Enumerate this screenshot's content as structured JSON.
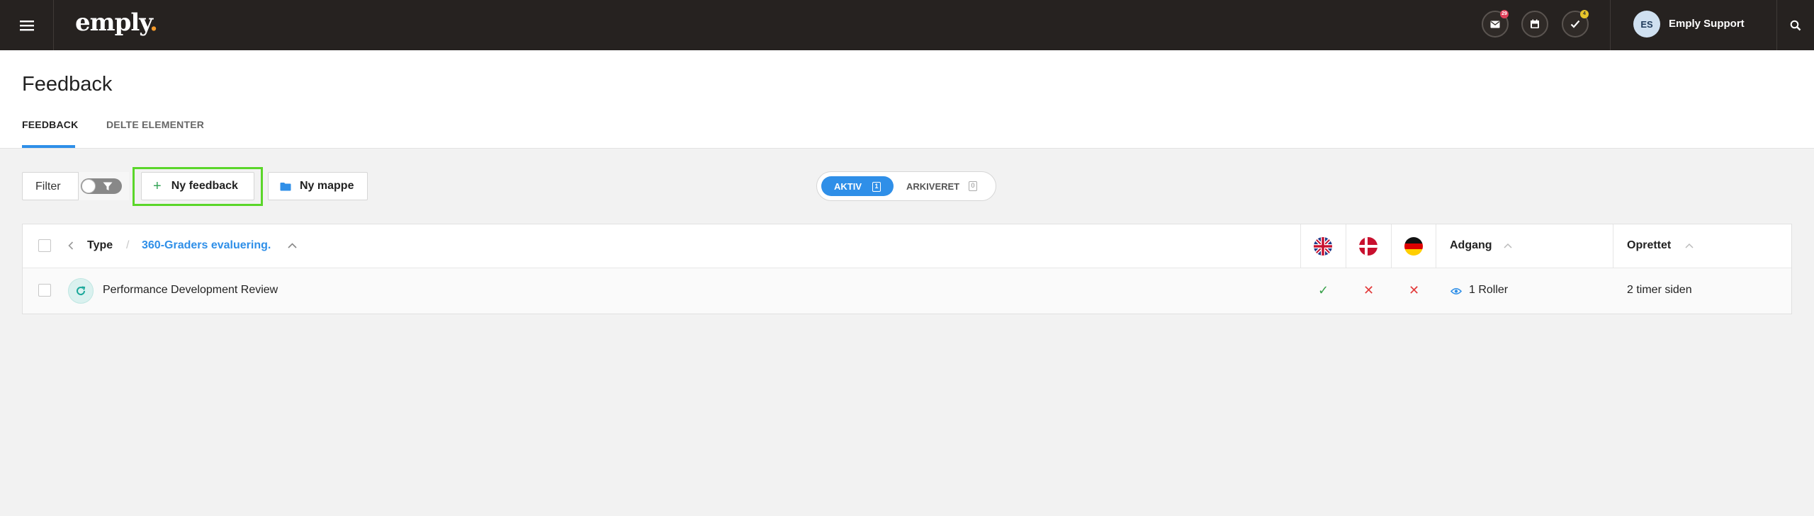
{
  "app": {
    "logo_text": "emply",
    "logo_dot": ".",
    "notifications": {
      "mail_badge": "29",
      "tasks_badge": "4"
    },
    "user": {
      "initials": "ES",
      "name": "Emply Support"
    }
  },
  "page": {
    "title": "Feedback",
    "tabs": [
      {
        "label": "FEEDBACK",
        "active": true
      },
      {
        "label": "DELTE ELEMENTER",
        "active": false
      }
    ]
  },
  "toolbar": {
    "filter_label": "Filter",
    "new_feedback_label": "Ny feedback",
    "new_folder_label": "Ny mappe",
    "status": {
      "active_label": "AKTIV",
      "active_count": "1",
      "archived_label": "ARKIVERET",
      "archived_count": "0"
    }
  },
  "table": {
    "breadcrumb": {
      "root": "Type",
      "separator": "/",
      "current": "360-Graders evaluering."
    },
    "columns": {
      "access": "Adgang",
      "created": "Oprettet"
    },
    "languages": [
      "english-flag-icon",
      "danish-flag-icon",
      "german-flag-icon"
    ],
    "rows": [
      {
        "name": "Performance Development Review",
        "lang_marks": [
          "✓",
          "✕",
          "✕"
        ],
        "access": "1 Roller",
        "created": "2 timer siden"
      }
    ]
  },
  "colors": {
    "topbar": "#262220",
    "accent": "#2f8fe8",
    "highlight_outline": "#5bd62a",
    "yes": "#3aa14b",
    "no": "#e23a3a"
  }
}
